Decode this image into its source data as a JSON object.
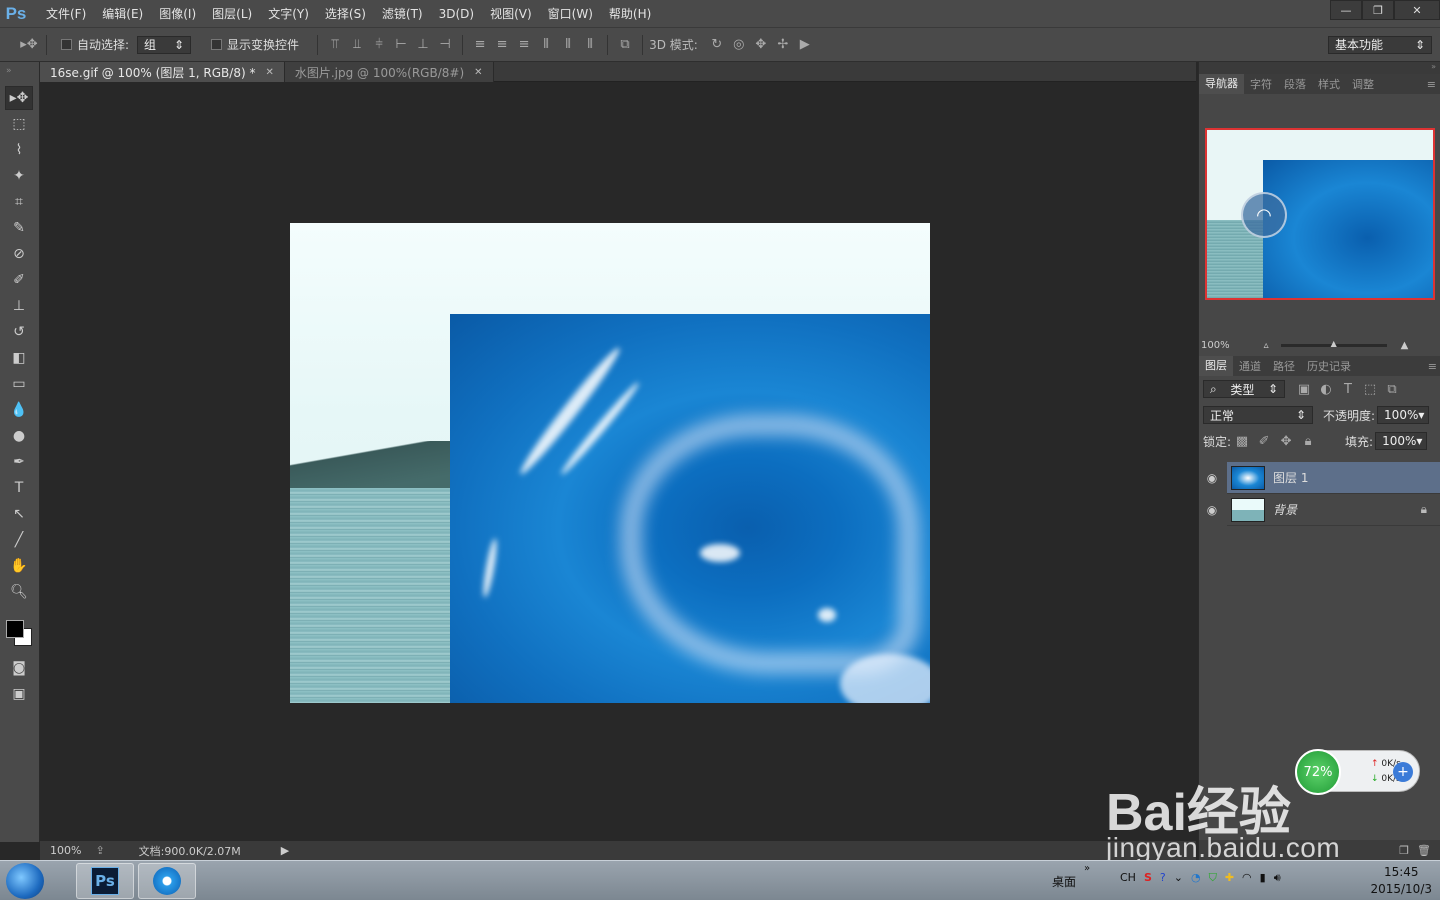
{
  "app": {
    "logo": "Ps"
  },
  "menu": [
    "文件(F)",
    "编辑(E)",
    "图像(I)",
    "图层(L)",
    "文字(Y)",
    "选择(S)",
    "滤镜(T)",
    "3D(D)",
    "视图(V)",
    "窗口(W)",
    "帮助(H)"
  ],
  "options": {
    "auto_select_label": "自动选择:",
    "auto_select_value": "组",
    "show_transform_label": "显示变换控件",
    "mode_3d_label": "3D 模式:",
    "workspace": "基本功能"
  },
  "tabs": [
    {
      "label": "16se.gif @ 100% (图层 1, RGB/8) *",
      "active": true
    },
    {
      "label": "水图片.jpg @ 100%(RGB/8#)",
      "active": false
    }
  ],
  "status": {
    "zoom": "100%",
    "doc": "文档:900.0K/2.07M"
  },
  "panel_tabs_top": [
    "导航器",
    "字符",
    "段落",
    "样式",
    "调整"
  ],
  "navigator_zoom": "100%",
  "panel_tabs_layers": [
    "图层",
    "通道",
    "路径",
    "历史记录"
  ],
  "layers_panel": {
    "filter": "类型",
    "blend_mode": "正常",
    "opacity_label": "不透明度:",
    "opacity": "100%",
    "lock_label": "锁定:",
    "fill_label": "填充:",
    "fill": "100%",
    "layers": [
      {
        "name": "图层 1",
        "active": true
      },
      {
        "name": "背景",
        "active": false
      }
    ]
  },
  "taskbar": {
    "desktop_label": "桌面",
    "ime": "CH",
    "time": "15:45",
    "date": "2015/10/3"
  },
  "net_widget": {
    "percent": "72%",
    "up": "0K/s",
    "down": "0K/s"
  },
  "watermark": {
    "brand": "Bai经验",
    "url": "jingyan.baidu.com"
  }
}
